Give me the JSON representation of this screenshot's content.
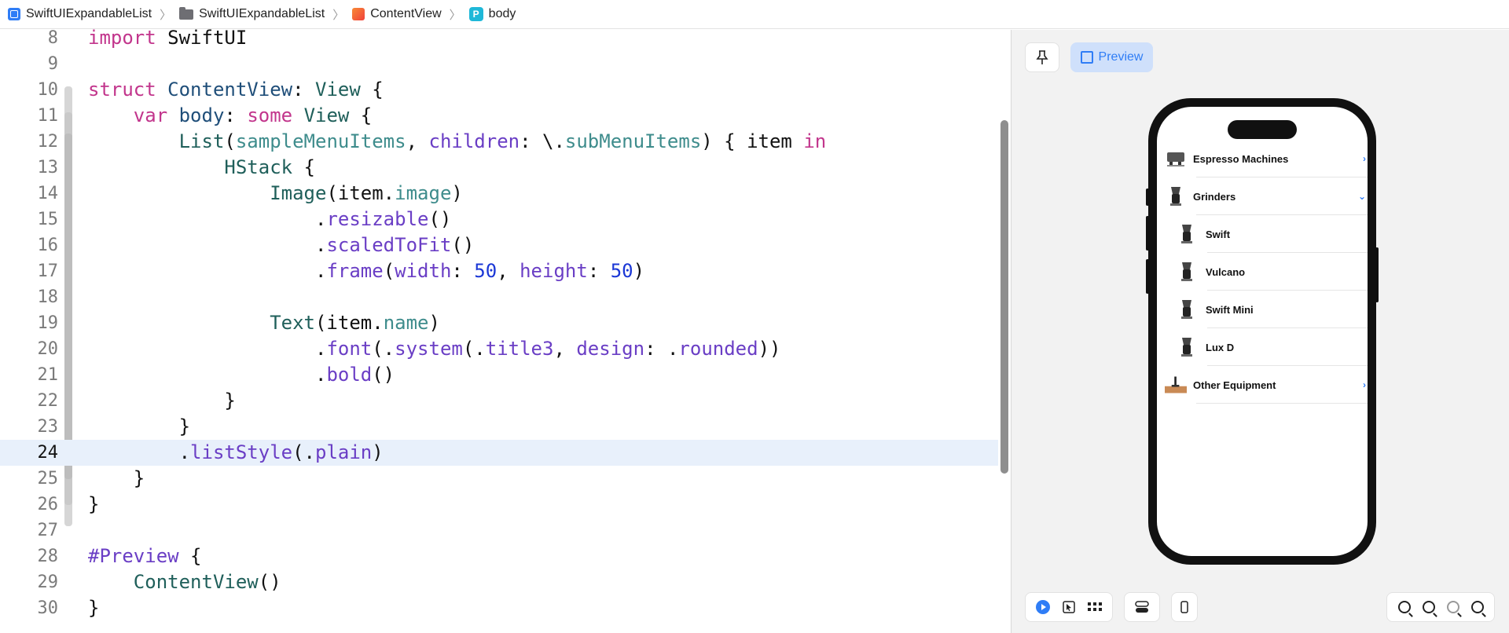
{
  "breadcrumb": {
    "items": [
      {
        "label": "SwiftUIExpandableList",
        "icon": "app-project-icon"
      },
      {
        "label": "SwiftUIExpandableList",
        "icon": "folder-icon"
      },
      {
        "label": "ContentView",
        "icon": "swift-file-icon"
      },
      {
        "label": "body",
        "icon": "property-icon",
        "badge": "P"
      }
    ]
  },
  "editor": {
    "active_line": "24",
    "lines": [
      {
        "n": "8"
      },
      {
        "n": "9"
      },
      {
        "n": "10"
      },
      {
        "n": "11"
      },
      {
        "n": "12"
      },
      {
        "n": "13"
      },
      {
        "n": "14"
      },
      {
        "n": "15"
      },
      {
        "n": "16"
      },
      {
        "n": "17"
      },
      {
        "n": "18"
      },
      {
        "n": "19"
      },
      {
        "n": "20"
      },
      {
        "n": "21"
      },
      {
        "n": "22"
      },
      {
        "n": "23"
      },
      {
        "n": "24"
      },
      {
        "n": "25"
      },
      {
        "n": "26"
      },
      {
        "n": "27"
      },
      {
        "n": "28"
      },
      {
        "n": "29"
      },
      {
        "n": "30"
      }
    ],
    "tokens": {
      "l8": [
        "import",
        " SwiftUI"
      ],
      "l10": [
        "struct",
        " ",
        "ContentView",
        ": ",
        "View",
        " {"
      ],
      "l11": [
        "    ",
        "var",
        " ",
        "body",
        ": ",
        "some",
        " ",
        "View",
        " {"
      ],
      "l12": [
        "        ",
        "List",
        "(",
        "sampleMenuItems",
        ", ",
        "children",
        ": \\.",
        "subMenuItems",
        ") { item ",
        "in"
      ],
      "l13": [
        "            ",
        "HStack",
        " {"
      ],
      "l14": [
        "                ",
        "Image",
        "(item.",
        "image",
        ")"
      ],
      "l15": [
        "                    .",
        "resizable",
        "()"
      ],
      "l16": [
        "                    .",
        "scaledToFit",
        "()"
      ],
      "l17": [
        "                    .",
        "frame",
        "(",
        "width",
        ": ",
        "50",
        ", ",
        "height",
        ": ",
        "50",
        ")"
      ],
      "l19": [
        "                ",
        "Text",
        "(item.",
        "name",
        ")"
      ],
      "l20": [
        "                    .",
        "font",
        "(.",
        "system",
        "(.",
        "title3",
        ", ",
        "design",
        ": .",
        "rounded",
        "))"
      ],
      "l21": [
        "                    .",
        "bold",
        "()"
      ],
      "l22": [
        "            }"
      ],
      "l23": [
        "        }"
      ],
      "l24": [
        "        .",
        "listStyle",
        "(.",
        "plain",
        ")"
      ],
      "l25": [
        "    }"
      ],
      "l26": [
        "}"
      ],
      "l28": [
        "#Preview",
        " {"
      ],
      "l29": [
        "    ",
        "ContentView",
        "()"
      ],
      "l30": [
        "}"
      ]
    }
  },
  "preview": {
    "preview_label": "Preview",
    "list": [
      {
        "label": "Espresso Machines",
        "chevron": "›",
        "indent": false,
        "icon": "espresso-machine-icon"
      },
      {
        "label": "Grinders",
        "chevron": "⌄",
        "indent": false,
        "icon": "grinder-icon"
      },
      {
        "label": "Swift",
        "chevron": "",
        "indent": true,
        "icon": "grinder-icon"
      },
      {
        "label": "Vulcano",
        "chevron": "",
        "indent": true,
        "icon": "grinder-icon"
      },
      {
        "label": "Swift Mini",
        "chevron": "",
        "indent": true,
        "icon": "grinder-icon"
      },
      {
        "label": "Lux D",
        "chevron": "",
        "indent": true,
        "icon": "grinder-icon"
      },
      {
        "label": "Other Equipment",
        "chevron": "›",
        "indent": false,
        "icon": "equipment-icon"
      }
    ]
  },
  "colors": {
    "accent": "#2f7df6",
    "keyword": "#c2358c",
    "number": "#1b37d6"
  }
}
